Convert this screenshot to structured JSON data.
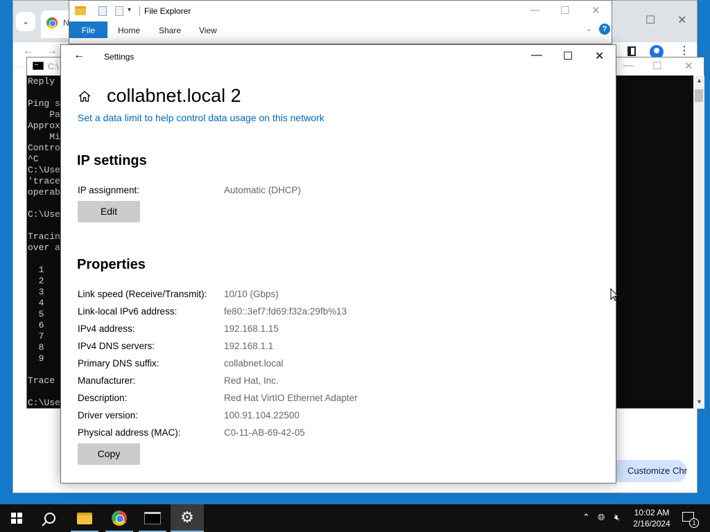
{
  "chrome": {
    "tab_title": "N",
    "customize_label": "Customize Chrome"
  },
  "explorer": {
    "title": "File Explorer",
    "ribbon_tabs": [
      "File",
      "Home",
      "Share",
      "View"
    ]
  },
  "cmd": {
    "title": "C:\\",
    "lines": [
      "Reply",
      "",
      "Ping s",
      "    Pa",
      "Approx",
      "    Mi",
      "Contro",
      "^C",
      "C:\\Use",
      "'trace",
      "operab",
      "",
      "C:\\Use",
      "",
      "Tracin",
      "over a",
      "",
      "  1",
      "  2",
      "  3",
      "  4",
      "  5",
      "  6",
      "  7",
      "  8",
      "  9",
      "",
      "Trace",
      "",
      "C:\\Use"
    ]
  },
  "settings": {
    "window_title": "Settings",
    "page_title": "collabnet.local 2",
    "data_limit_link": "Set a data limit to help control data usage on this network",
    "ip_section": {
      "heading": "IP settings",
      "label": "IP assignment:",
      "value": "Automatic (DHCP)",
      "edit_label": "Edit"
    },
    "properties": {
      "heading": "Properties",
      "rows": [
        {
          "label": "Link speed (Receive/Transmit):",
          "value": "10/10 (Gbps)"
        },
        {
          "label": "Link-local IPv6 address:",
          "value": "fe80::3ef7:fd69:f32a:29fb%13"
        },
        {
          "label": "IPv4 address:",
          "value": "192.168.1.15"
        },
        {
          "label": "IPv4 DNS servers:",
          "value": "192.168.1.1"
        },
        {
          "label": "Primary DNS suffix:",
          "value": "collabnet.local"
        },
        {
          "label": "Manufacturer:",
          "value": "Red Hat, Inc."
        },
        {
          "label": "Description:",
          "value": "Red Hat VirtIO Ethernet Adapter"
        },
        {
          "label": "Driver version:",
          "value": "100.91.104.22500"
        },
        {
          "label": "Physical address (MAC):",
          "value": "C0-11-AB-69-42-05"
        }
      ],
      "copy_label": "Copy"
    }
  },
  "taskbar": {
    "time": "10:02 AM",
    "date": "2/16/2024",
    "notification_count": "1"
  },
  "colors": {
    "desktop": "#1479c9",
    "link": "#0067b8",
    "accent": "#1979ca"
  }
}
